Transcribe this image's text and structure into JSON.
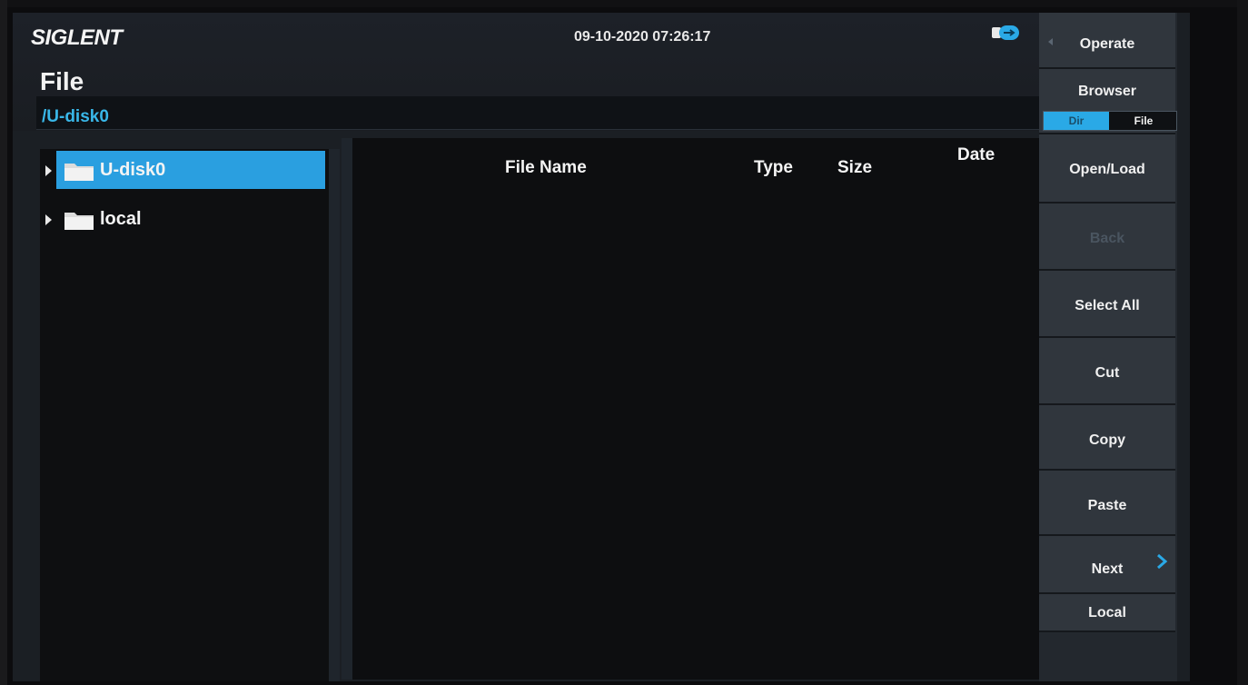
{
  "header": {
    "brand": "SIGLENT",
    "datetime": "09-10-2020 07:26:17",
    "usb_icon": "usb-connected-icon"
  },
  "page": {
    "title": "File",
    "path": "/U-disk0"
  },
  "tree": {
    "items": [
      {
        "label": "U-disk0",
        "icon": "folder-icon",
        "selected": true
      },
      {
        "label": "local",
        "icon": "folder-icon",
        "selected": false
      }
    ]
  },
  "file_list": {
    "columns": [
      "File Name",
      "Type",
      "Size",
      "Date"
    ],
    "rows": []
  },
  "softkeys": {
    "operate": "Operate",
    "browser": "Browser",
    "browser_options": [
      "Dir",
      "File"
    ],
    "browser_active": "Dir",
    "open_load": "Open/Load",
    "back": "Back",
    "select_all": "Select All",
    "cut": "Cut",
    "copy": "Copy",
    "paste": "Paste",
    "next": "Next",
    "local": "Local"
  },
  "colors": {
    "accent": "#2a9fe0",
    "path_text": "#39b7e8",
    "background": "#0d0e10"
  }
}
